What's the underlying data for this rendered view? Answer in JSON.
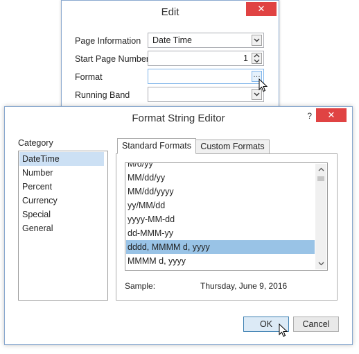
{
  "edit_dialog": {
    "title": "Edit",
    "close_glyph": "✕",
    "rows": [
      {
        "label": "Page Information",
        "value": "Date Time",
        "control": "dropdown"
      },
      {
        "label": "Start Page Number",
        "value": "1",
        "control": "spinner"
      },
      {
        "label": "Format",
        "value": "",
        "control": "ellipsis",
        "button_glyph": "…"
      },
      {
        "label": "Running Band",
        "value": "",
        "control": "dropdown"
      }
    ]
  },
  "format_editor": {
    "title": "Format String Editor",
    "help_glyph": "?",
    "close_glyph": "✕",
    "category": {
      "label": "Category",
      "items": [
        "DateTime",
        "Number",
        "Percent",
        "Currency",
        "Special",
        "General"
      ],
      "selected_index": 0
    },
    "tabs": [
      "Standard Formats",
      "Custom Formats"
    ],
    "active_tab": 0,
    "formats": {
      "partial_top": "M/d/yy",
      "items": [
        "MM/dd/yy",
        "MM/dd/yyyy",
        "yy/MM/dd",
        "yyyy-MM-dd",
        "dd-MMM-yy",
        "dddd, MMMM d, yyyy",
        "MMMM d, yyyy"
      ],
      "selected_index": 5
    },
    "sample_label": "Sample:",
    "sample_value": "Thursday, June 9, 2016",
    "ok_label": "OK",
    "cancel_label": "Cancel"
  },
  "icons": {
    "dropdown": "chevron-down-icon",
    "spin_up": "spin-up-icon",
    "spin_down": "spin-down-icon",
    "scroll_up": "scroll-up-arrow-icon",
    "scroll_down": "scroll-down-arrow-icon",
    "cursor": "mouse-pointer-icon"
  },
  "colors": {
    "selection_list": "#99c3e6",
    "selection_category": "#cce0f4",
    "close_button": "#e04343",
    "dialog_border": "#8aa9cf",
    "ok_border": "#3c7fb1"
  }
}
